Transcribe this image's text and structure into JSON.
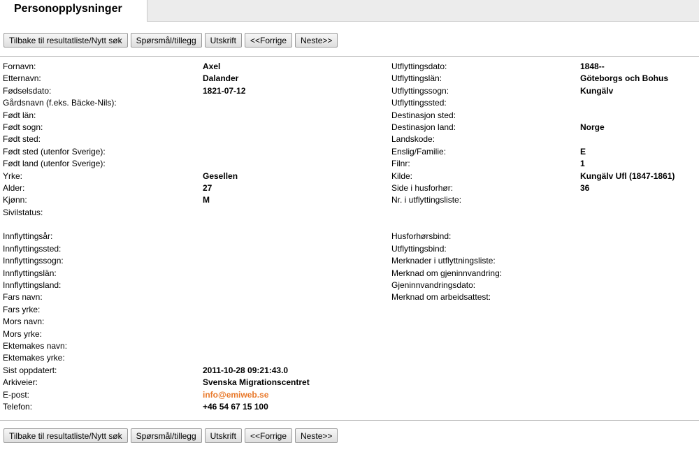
{
  "title": "Personopplysninger",
  "buttons": {
    "back": "Tilbake til resultatliste/Nytt søk",
    "question": "Spørsmål/tillegg",
    "print": "Utskrift",
    "prev": "<<Forrige",
    "next": "Neste>>"
  },
  "left": [
    {
      "label": "Fornavn:",
      "value": "Axel"
    },
    {
      "label": "Etternavn:",
      "value": "Dalander"
    },
    {
      "label": "Fødselsdato:",
      "value": "1821-07-12"
    },
    {
      "label": "Gårdsnavn (f.eks. Bäcke-Nils):",
      "value": ""
    },
    {
      "label": "Født län:",
      "value": ""
    },
    {
      "label": "Født sogn:",
      "value": ""
    },
    {
      "label": "Født sted:",
      "value": ""
    },
    {
      "label": "Født sted (utenfor Sverige):",
      "value": ""
    },
    {
      "label": "Født land (utenfor Sverige):",
      "value": ""
    },
    {
      "label": "Yrke:",
      "value": "Gesellen"
    },
    {
      "label": "Alder:",
      "value": "27"
    },
    {
      "label": "Kjønn:",
      "value": "M"
    },
    {
      "label": "Sivilstatus:",
      "value": ""
    },
    {
      "label": "",
      "value": ""
    },
    {
      "label": "Innflyttingsår:",
      "value": ""
    },
    {
      "label": "Innflyttingssted:",
      "value": ""
    },
    {
      "label": "Innflyttingssogn:",
      "value": ""
    },
    {
      "label": "Innflyttingslän:",
      "value": ""
    },
    {
      "label": "Innflyttingsland:",
      "value": ""
    },
    {
      "label": "Fars navn:",
      "value": ""
    },
    {
      "label": "Fars yrke:",
      "value": ""
    },
    {
      "label": "Mors navn:",
      "value": ""
    },
    {
      "label": "Mors yrke:",
      "value": ""
    },
    {
      "label": "Ektemakes navn:",
      "value": ""
    },
    {
      "label": "Ektemakes yrke:",
      "value": ""
    },
    {
      "label": "Sist oppdatert:",
      "value": "2011-10-28 09:21:43.0"
    },
    {
      "label": "Arkiveier:",
      "value": "Svenska Migrationscentret"
    },
    {
      "label": "E-post:",
      "value": "info@emiweb.se"
    },
    {
      "label": "Telefon:",
      "value": "+46 54 67 15 100"
    }
  ],
  "right": [
    {
      "label": "Utflyttingsdato:",
      "value": "1848--"
    },
    {
      "label": "Utflyttingslän:",
      "value": "Göteborgs och Bohus"
    },
    {
      "label": "Utflyttingssogn:",
      "value": "Kungälv"
    },
    {
      "label": "Utflyttingssted:",
      "value": ""
    },
    {
      "label": "Destinasjon sted:",
      "value": ""
    },
    {
      "label": "Destinasjon land:",
      "value": "Norge"
    },
    {
      "label": "Landskode:",
      "value": ""
    },
    {
      "label": "Enslig/Familie:",
      "value": "E"
    },
    {
      "label": "Filnr:",
      "value": "1"
    },
    {
      "label": "Kilde:",
      "value": "Kungälv Ufl (1847-1861)"
    },
    {
      "label": "Side i husforhør:",
      "value": "36"
    },
    {
      "label": "Nr. i utflyttingsliste:",
      "value": ""
    },
    {
      "label": "",
      "value": ""
    },
    {
      "label": "",
      "value": ""
    },
    {
      "label": "Husforhørsbind:",
      "value": ""
    },
    {
      "label": "Utflyttingsbind:",
      "value": ""
    },
    {
      "label": "Merknader i utflyttningsliste:",
      "value": ""
    },
    {
      "label": "Merknad om gjeninnvandring:",
      "value": ""
    },
    {
      "label": "Gjeninnvandringsdato:",
      "value": ""
    },
    {
      "label": "Merknad om arbeidsattest:",
      "value": ""
    }
  ]
}
